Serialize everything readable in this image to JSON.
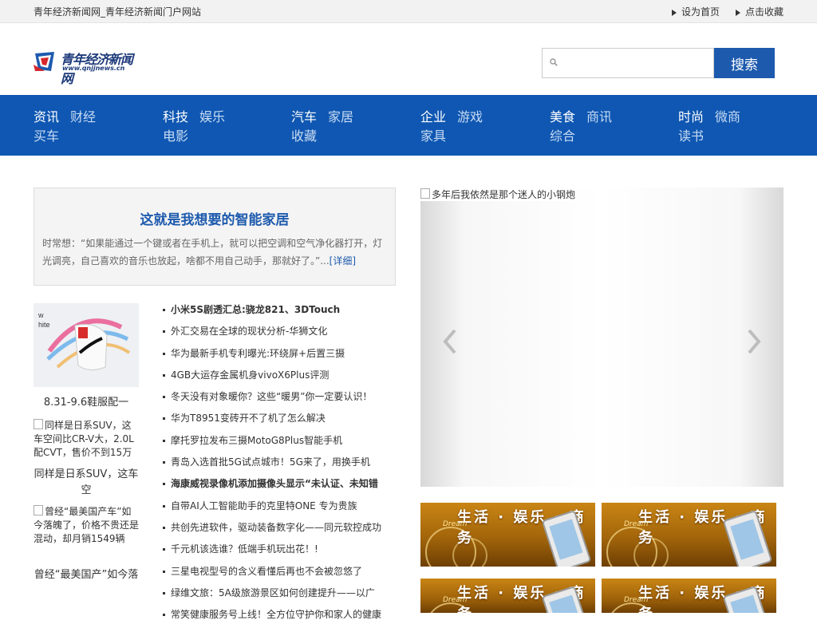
{
  "topbar": {
    "site_title": "青年经济新闻网_青年经济新闻门户网站",
    "set_home": "设为首页",
    "bookmark": "点击收藏"
  },
  "logo": {
    "name": "青年经济新闻网",
    "url": "www.qnjjnews.cn"
  },
  "search": {
    "placeholder": "",
    "button": "搜索"
  },
  "nav": [
    {
      "main": "资讯",
      "sub": "财经",
      "bottom": "买车"
    },
    {
      "main": "科技",
      "sub": "娱乐",
      "bottom": "电影"
    },
    {
      "main": "汽车",
      "sub": "家居",
      "bottom": "收藏"
    },
    {
      "main": "企业",
      "sub": "游戏",
      "bottom": "家具"
    },
    {
      "main": "美食",
      "sub": "商讯",
      "bottom": "综合"
    },
    {
      "main": "时尚",
      "sub": "微商",
      "bottom": "读书"
    }
  ],
  "feature": {
    "title": "这就是我想要的智能家居",
    "summary": "时常想：“如果能通过一个键或者在手机上，就可以把空调和空气净化器打开，灯光调亮，自己喜欢的音乐也放起，啥都不用自己动手，那就好了。”...",
    "more": "[详细]"
  },
  "thumbs": [
    {
      "caption": "8.31-9.6鞋服配一",
      "alt": ""
    },
    {
      "caption": "同样是日系SUV，这车空",
      "alt": "同样是日系SUV，这车空间比CR-V大，2.0L配CVT，售价不到15万"
    },
    {
      "caption": "曾经“最美国产”如今落",
      "alt": "曾经“最美国产车”如今落魄了，价格不贵还是混动，却月销1549辆"
    }
  ],
  "news": [
    {
      "text": "小米5S剧透汇总:骁龙821、3DTouch",
      "bold": true
    },
    {
      "text": "外汇交易在全球的现状分析-华狮文化",
      "bold": false
    },
    {
      "text": "华为最新手机专利曝光:环绕屏+后置三摄",
      "bold": false
    },
    {
      "text": "4GB大运存金属机身vivoX6Plus评测",
      "bold": false
    },
    {
      "text": "冬天没有对象暖你？这些“暖男”你一定要认识！",
      "bold": false
    },
    {
      "text": "华为T8951变砖开不了机了怎么解决",
      "bold": false
    },
    {
      "text": "摩托罗拉发布三摄MotoG8Plus智能手机",
      "bold": false
    },
    {
      "text": "青岛入选首批5G试点城市！5G来了，用换手机",
      "bold": false
    },
    {
      "text": "海康威视录像机添加摄像头显示“未认证、未知错",
      "bold": true
    },
    {
      "text": "自带AI人工智能助手的克里特ONE 专为贵族",
      "bold": false
    },
    {
      "text": "共创先进软件，驱动装备数字化——同元软控成功",
      "bold": false
    },
    {
      "text": "千元机该选谁？低端手机玩出花！!",
      "bold": false
    },
    {
      "text": "三星电视型号的含义看懂后再也不会被忽悠了",
      "bold": false
    },
    {
      "text": "绿维文旅：5A级旅游景区如何创建提升——以广",
      "bold": false
    },
    {
      "text": "常笑健康服务号上线！全方位守护你和家人的健康",
      "bold": false
    }
  ],
  "slider": {
    "alt": "多年后我依然是那个迷人的小钢炮"
  },
  "banners": [
    {
      "text": "生活 · 娱乐 · 商务",
      "sub": "Dream"
    },
    {
      "text": "生活 · 娱乐 · 商务",
      "sub": "Dream"
    },
    {
      "text": "生活 · 娱乐 · 商务",
      "sub": "Dream"
    },
    {
      "text": "生活 · 娱乐 · 商务",
      "sub": "Dream"
    }
  ]
}
